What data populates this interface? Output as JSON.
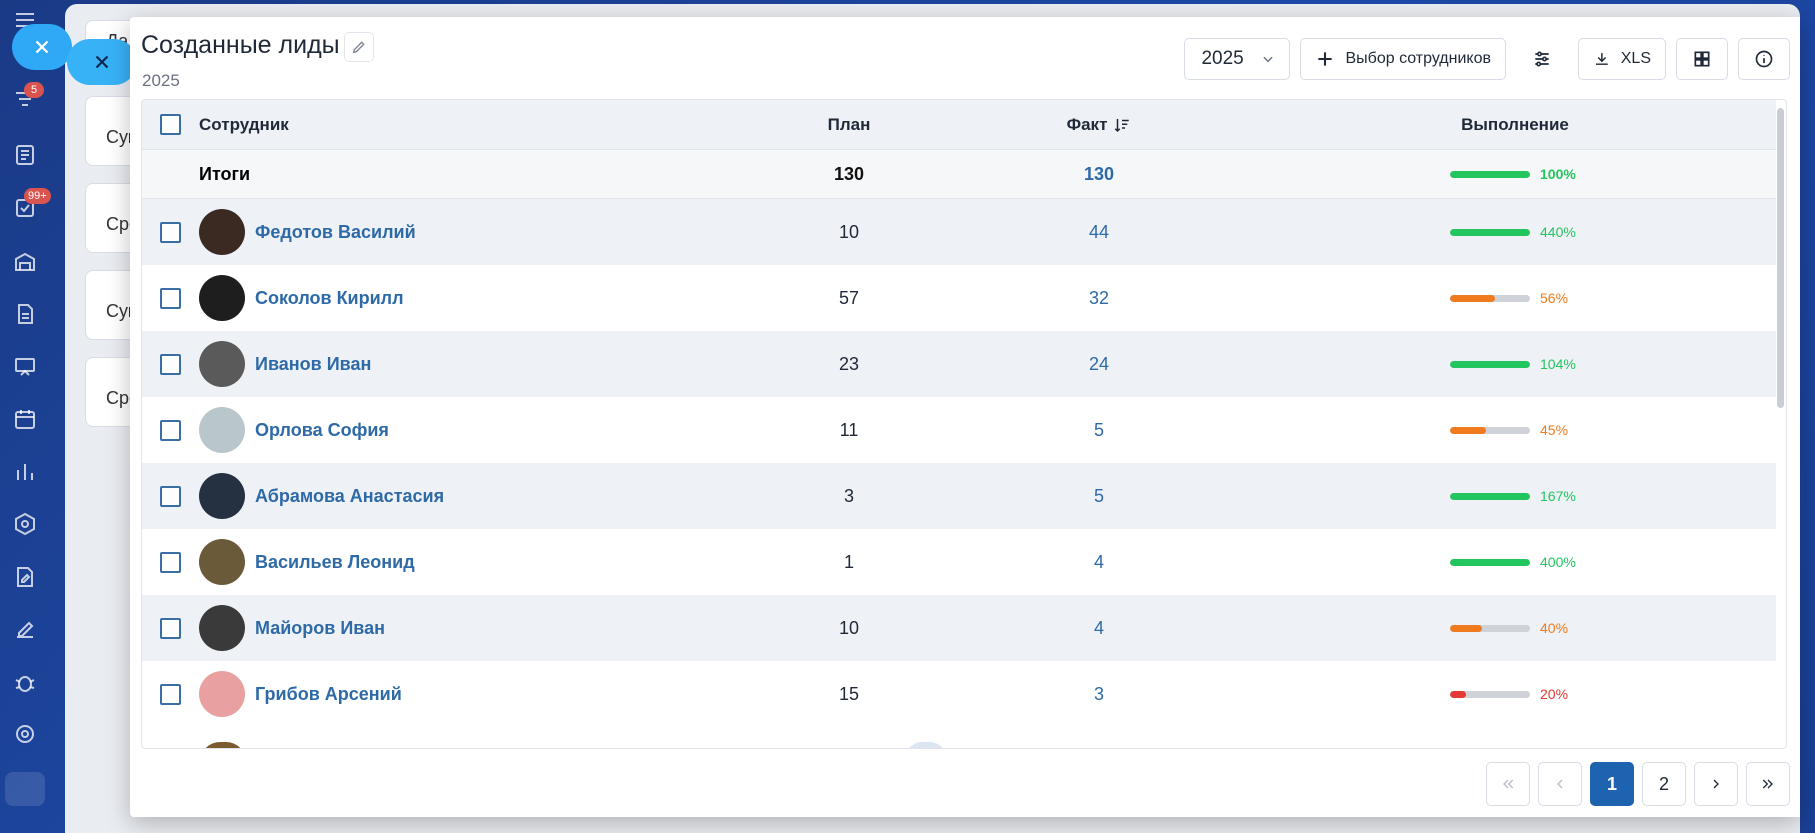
{
  "nav": {
    "funnel_badge": "5",
    "tasks_badge": "99+"
  },
  "back_panel": {
    "cards": [
      "Да",
      "Сум",
      "Сре",
      "Сум",
      "Сре"
    ]
  },
  "modal": {
    "title": "Созданные лиды",
    "subtitle": "2025",
    "year_select": "2025",
    "choose_employees_label": "Выбор сотрудников",
    "export_label": "XLS"
  },
  "table": {
    "headers": {
      "employee": "Сотрудник",
      "plan": "План",
      "fact": "Факт",
      "performance": "Выполнение"
    },
    "totals": {
      "label": "Итоги",
      "plan": "130",
      "fact": "130",
      "percent": "100%",
      "progress": 100,
      "color": "#22c55e"
    },
    "rows": [
      {
        "name": "Федотов Василий",
        "plan": "10",
        "fact": "44",
        "percent": "440%",
        "progress": 100,
        "color": "#22c55e",
        "avatar_color": "#3b2a22"
      },
      {
        "name": "Соколов Кирилл",
        "plan": "57",
        "fact": "32",
        "percent": "56%",
        "progress": 56,
        "color": "#f07a1e",
        "avatar_color": "#1e1e1e"
      },
      {
        "name": "Иванов Иван",
        "plan": "23",
        "fact": "24",
        "percent": "104%",
        "progress": 100,
        "color": "#22c55e",
        "avatar_color": "#5a5a5a"
      },
      {
        "name": "Орлова София",
        "plan": "11",
        "fact": "5",
        "percent": "45%",
        "progress": 45,
        "color": "#f07a1e",
        "avatar_color": "#b9c6cc"
      },
      {
        "name": "Абрамова Анастасия",
        "plan": "3",
        "fact": "5",
        "percent": "167%",
        "progress": 100,
        "color": "#22c55e",
        "avatar_color": "#253040"
      },
      {
        "name": "Васильев Леонид",
        "plan": "1",
        "fact": "4",
        "percent": "400%",
        "progress": 100,
        "color": "#22c55e",
        "avatar_color": "#6b5a3a"
      },
      {
        "name": "Майоров Иван",
        "plan": "10",
        "fact": "4",
        "percent": "40%",
        "progress": 40,
        "color": "#f07a1e",
        "avatar_color": "#3a3a3a"
      },
      {
        "name": "Грибов Арсений",
        "plan": "15",
        "fact": "3",
        "percent": "20%",
        "progress": 20,
        "color": "#e53935",
        "avatar_color": "#e8a0a0"
      }
    ]
  },
  "pagination": {
    "pages": [
      "1",
      "2"
    ],
    "current": "1"
  }
}
